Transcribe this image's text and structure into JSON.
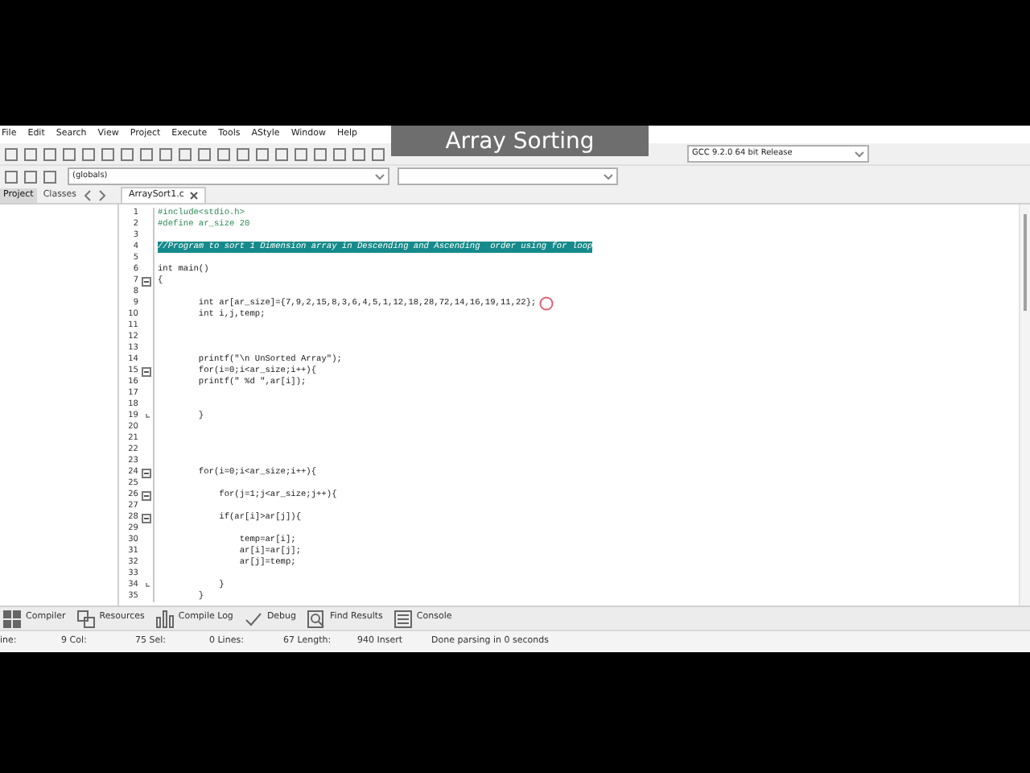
{
  "overlay_title": "Array Sorting",
  "menu": [
    "File",
    "Edit",
    "Search",
    "View",
    "Project",
    "Execute",
    "Tools",
    "AStyle",
    "Window",
    "Help"
  ],
  "compiler_combo": {
    "value": "GCC 9.2.0 64 bit Release"
  },
  "scope_combo": {
    "value": "(globals)"
  },
  "left_tabs": [
    {
      "label": "Project",
      "selected": true
    },
    {
      "label": "Classes",
      "selected": false
    }
  ],
  "editor_tabs": [
    {
      "label": "ArraySort1.c",
      "selected": true
    }
  ],
  "code_lines": [
    {
      "n": "1",
      "text": "#include<stdio.h>",
      "kind": "preprocessor",
      "fold_toggle": false,
      "fold_end": false,
      "cursor": false
    },
    {
      "n": "2",
      "text": "#define ar_size 20",
      "kind": "preprocessor",
      "fold_toggle": false,
      "fold_end": false,
      "cursor": false
    },
    {
      "n": "3",
      "fold_toggle": false,
      "fold_end": false,
      "cursor": false
    },
    {
      "n": "4",
      "text": "//Program to sort 1 Dimension array in Descending and Ascending  order using for loop",
      "kind": "highlighted-comment",
      "fold_toggle": false,
      "fold_end": false,
      "cursor": false
    },
    {
      "n": "5",
      "fold_toggle": false,
      "fold_end": false,
      "cursor": false
    },
    {
      "n": "6",
      "text": "int main()",
      "kind": "code",
      "fold_toggle": false,
      "fold_end": false,
      "cursor": false
    },
    {
      "n": "7",
      "text": "{",
      "kind": "code",
      "fold_toggle": true,
      "fold_end": false,
      "cursor": false
    },
    {
      "n": "8",
      "fold_toggle": false,
      "fold_end": false,
      "cursor": false
    },
    {
      "n": "9",
      "text": "        int ar[ar_size]={7,9,2,15,8,3,6,4,5,1,12,18,28,72,14,16,19,11,22};",
      "kind": "code",
      "fold_toggle": false,
      "fold_end": false,
      "cursor": true
    },
    {
      "n": "10",
      "text": "        int i,j,temp;",
      "kind": "code",
      "fold_toggle": false,
      "fold_end": false,
      "cursor": false
    },
    {
      "n": "11",
      "fold_toggle": false,
      "fold_end": false,
      "cursor": false
    },
    {
      "n": "12",
      "fold_toggle": false,
      "fold_end": false,
      "cursor": false
    },
    {
      "n": "13",
      "fold_toggle": false,
      "fold_end": false,
      "cursor": false
    },
    {
      "n": "14",
      "text": "        printf(\"\\n UnSorted Array\");",
      "kind": "code",
      "fold_toggle": false,
      "fold_end": false,
      "cursor": false
    },
    {
      "n": "15",
      "text": "        for(i=0;i<ar_size;i++){",
      "kind": "code",
      "fold_toggle": true,
      "fold_end": false,
      "cursor": false
    },
    {
      "n": "16",
      "text": "        printf(\" %d \",ar[i]);",
      "kind": "code",
      "fold_toggle": false,
      "fold_end": false,
      "cursor": false
    },
    {
      "n": "17",
      "fold_toggle": false,
      "fold_end": false,
      "cursor": false
    },
    {
      "n": "18",
      "fold_toggle": false,
      "fold_end": false,
      "cursor": false
    },
    {
      "n": "19",
      "text": "        }",
      "kind": "code",
      "fold_toggle": false,
      "fold_end": true,
      "cursor": false
    },
    {
      "n": "20",
      "fold_toggle": false,
      "fold_end": false,
      "cursor": false
    },
    {
      "n": "21",
      "fold_toggle": false,
      "fold_end": false,
      "cursor": false
    },
    {
      "n": "22",
      "fold_toggle": false,
      "fold_end": false,
      "cursor": false
    },
    {
      "n": "23",
      "fold_toggle": false,
      "fold_end": false,
      "cursor": false
    },
    {
      "n": "24",
      "text": "        for(i=0;i<ar_size;i++){",
      "kind": "code",
      "fold_toggle": true,
      "fold_end": false,
      "cursor": false
    },
    {
      "n": "25",
      "fold_toggle": false,
      "fold_end": false,
      "cursor": false
    },
    {
      "n": "26",
      "text": "            for(j=1;j<ar_size;j++){",
      "kind": "code",
      "fold_toggle": true,
      "fold_end": false,
      "cursor": false
    },
    {
      "n": "27",
      "fold_toggle": false,
      "fold_end": false,
      "cursor": false
    },
    {
      "n": "28",
      "text": "            if(ar[i]>ar[j]){",
      "kind": "code",
      "fold_toggle": true,
      "fold_end": false,
      "cursor": false
    },
    {
      "n": "29",
      "fold_toggle": false,
      "fold_end": false,
      "cursor": false
    },
    {
      "n": "30",
      "text": "                temp=ar[i];",
      "kind": "code",
      "fold_toggle": false,
      "fold_end": false,
      "cursor": false
    },
    {
      "n": "31",
      "text": "                ar[i]=ar[j];",
      "kind": "code",
      "fold_toggle": false,
      "fold_end": false,
      "cursor": false
    },
    {
      "n": "32",
      "text": "                ar[j]=temp;",
      "kind": "code",
      "fold_toggle": false,
      "fold_end": false,
      "cursor": false
    },
    {
      "n": "33",
      "fold_toggle": false,
      "fold_end": false,
      "cursor": false
    },
    {
      "n": "34",
      "text": "            }",
      "kind": "code",
      "fold_toggle": false,
      "fold_end": true,
      "cursor": false
    },
    {
      "n": "35",
      "text": "        }",
      "kind": "code",
      "fold_toggle": false,
      "fold_end": false,
      "cursor": false
    }
  ],
  "bottom_tabs": [
    {
      "label": "Compiler"
    },
    {
      "label": "Resources"
    },
    {
      "label": "Compile Log"
    },
    {
      "label": "Debug"
    },
    {
      "label": "Find Results"
    },
    {
      "label": "Console"
    }
  ],
  "status_bar": [
    "ine:",
    "9 Col:",
    "75 Sel:",
    "0 Lines:",
    "67 Length:",
    "940 Insert",
    "Done parsing in 0 seconds"
  ]
}
